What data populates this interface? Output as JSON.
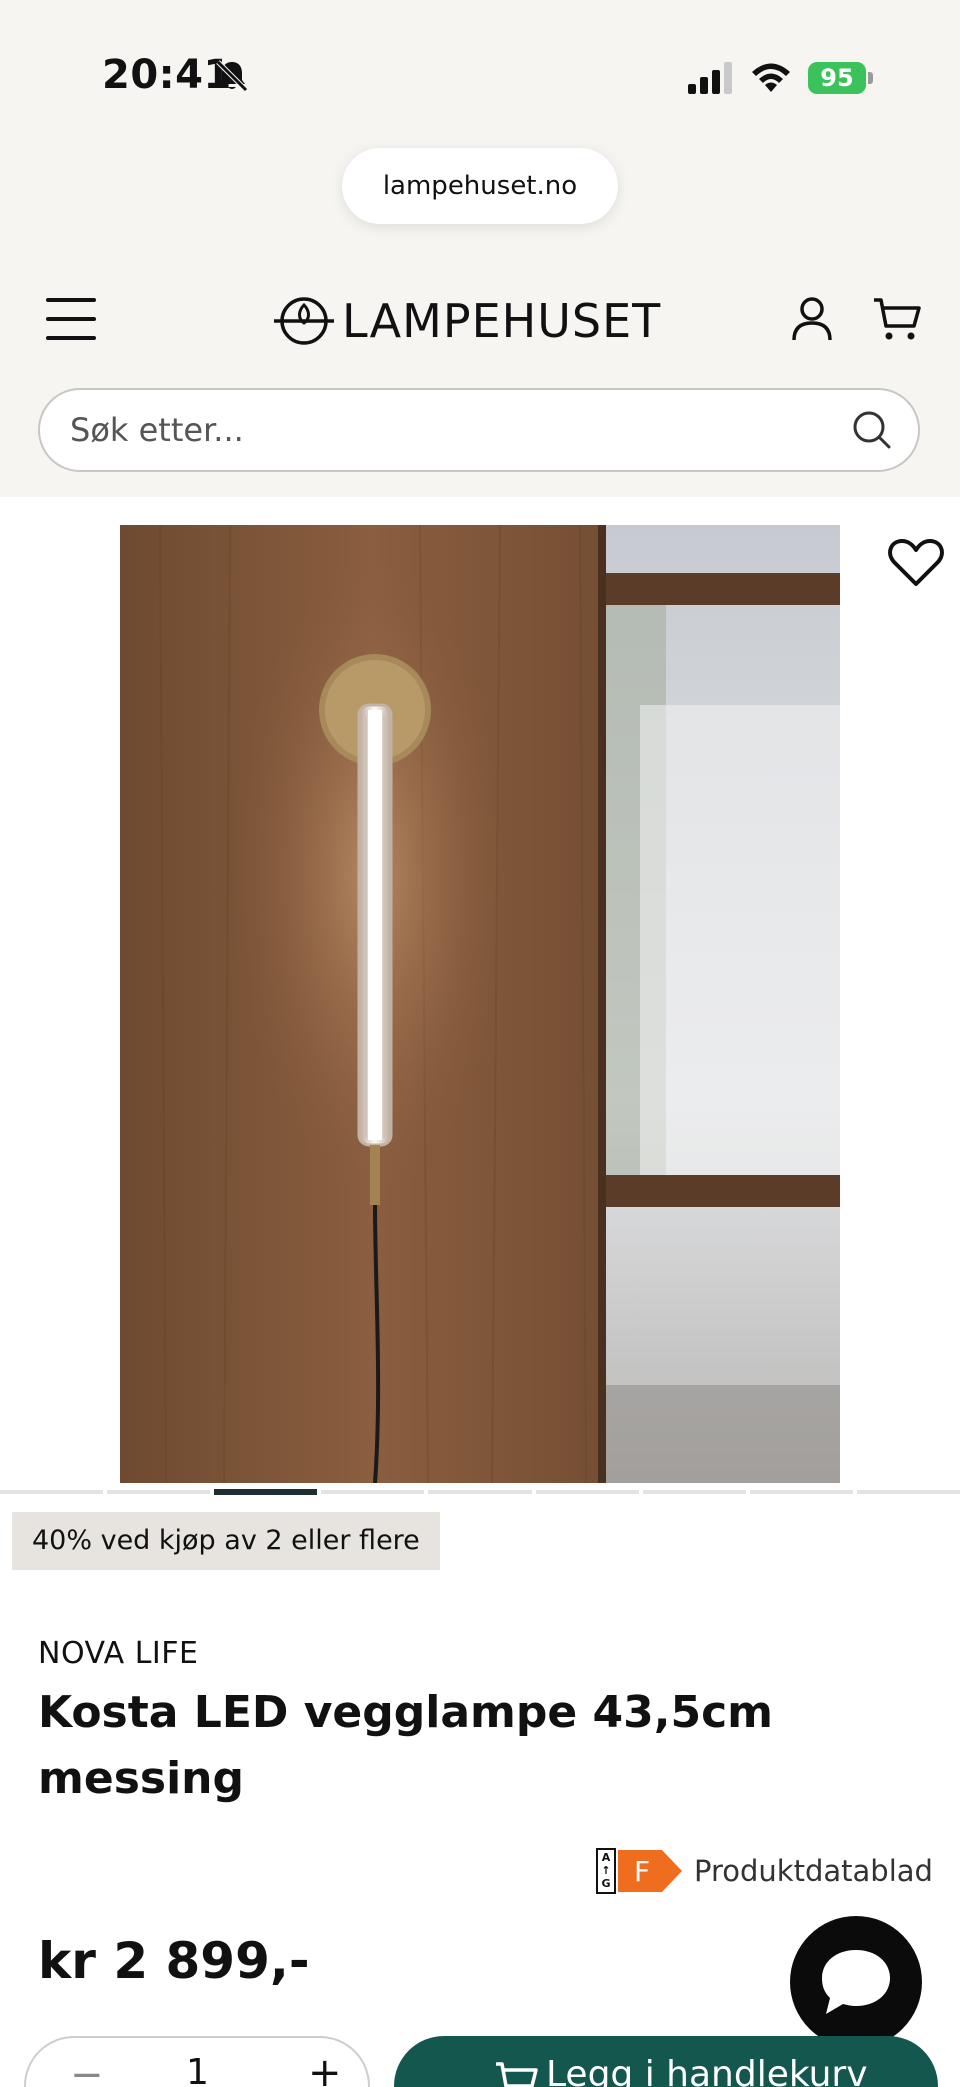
{
  "status_bar": {
    "time": "20:41",
    "battery": "95"
  },
  "browser": {
    "url": "lampehuset.no"
  },
  "header": {
    "brand": "LAMPEHUSET",
    "search_placeholder": "Søk etter..."
  },
  "gallery": {
    "slide_count": 10,
    "active_slide": 3
  },
  "product": {
    "promo": "40% ved kjøp av 2 eller flere",
    "brand": "NOVA LIFE",
    "title": "Kosta LED vegglampe 43,5cm messing",
    "energy_class": "F",
    "energy_scale": "A\n↑\nG",
    "datasheet_label": "Produktdatablad",
    "price": "kr 2 899,-"
  },
  "purchase": {
    "quantity": "1",
    "minus": "−",
    "plus": "+",
    "add_to_cart_label": "Legg i handlekurv"
  },
  "colors": {
    "accent_green": "#14574f",
    "energy_orange": "#ee6d1f",
    "battery_green": "#3cc25a"
  }
}
